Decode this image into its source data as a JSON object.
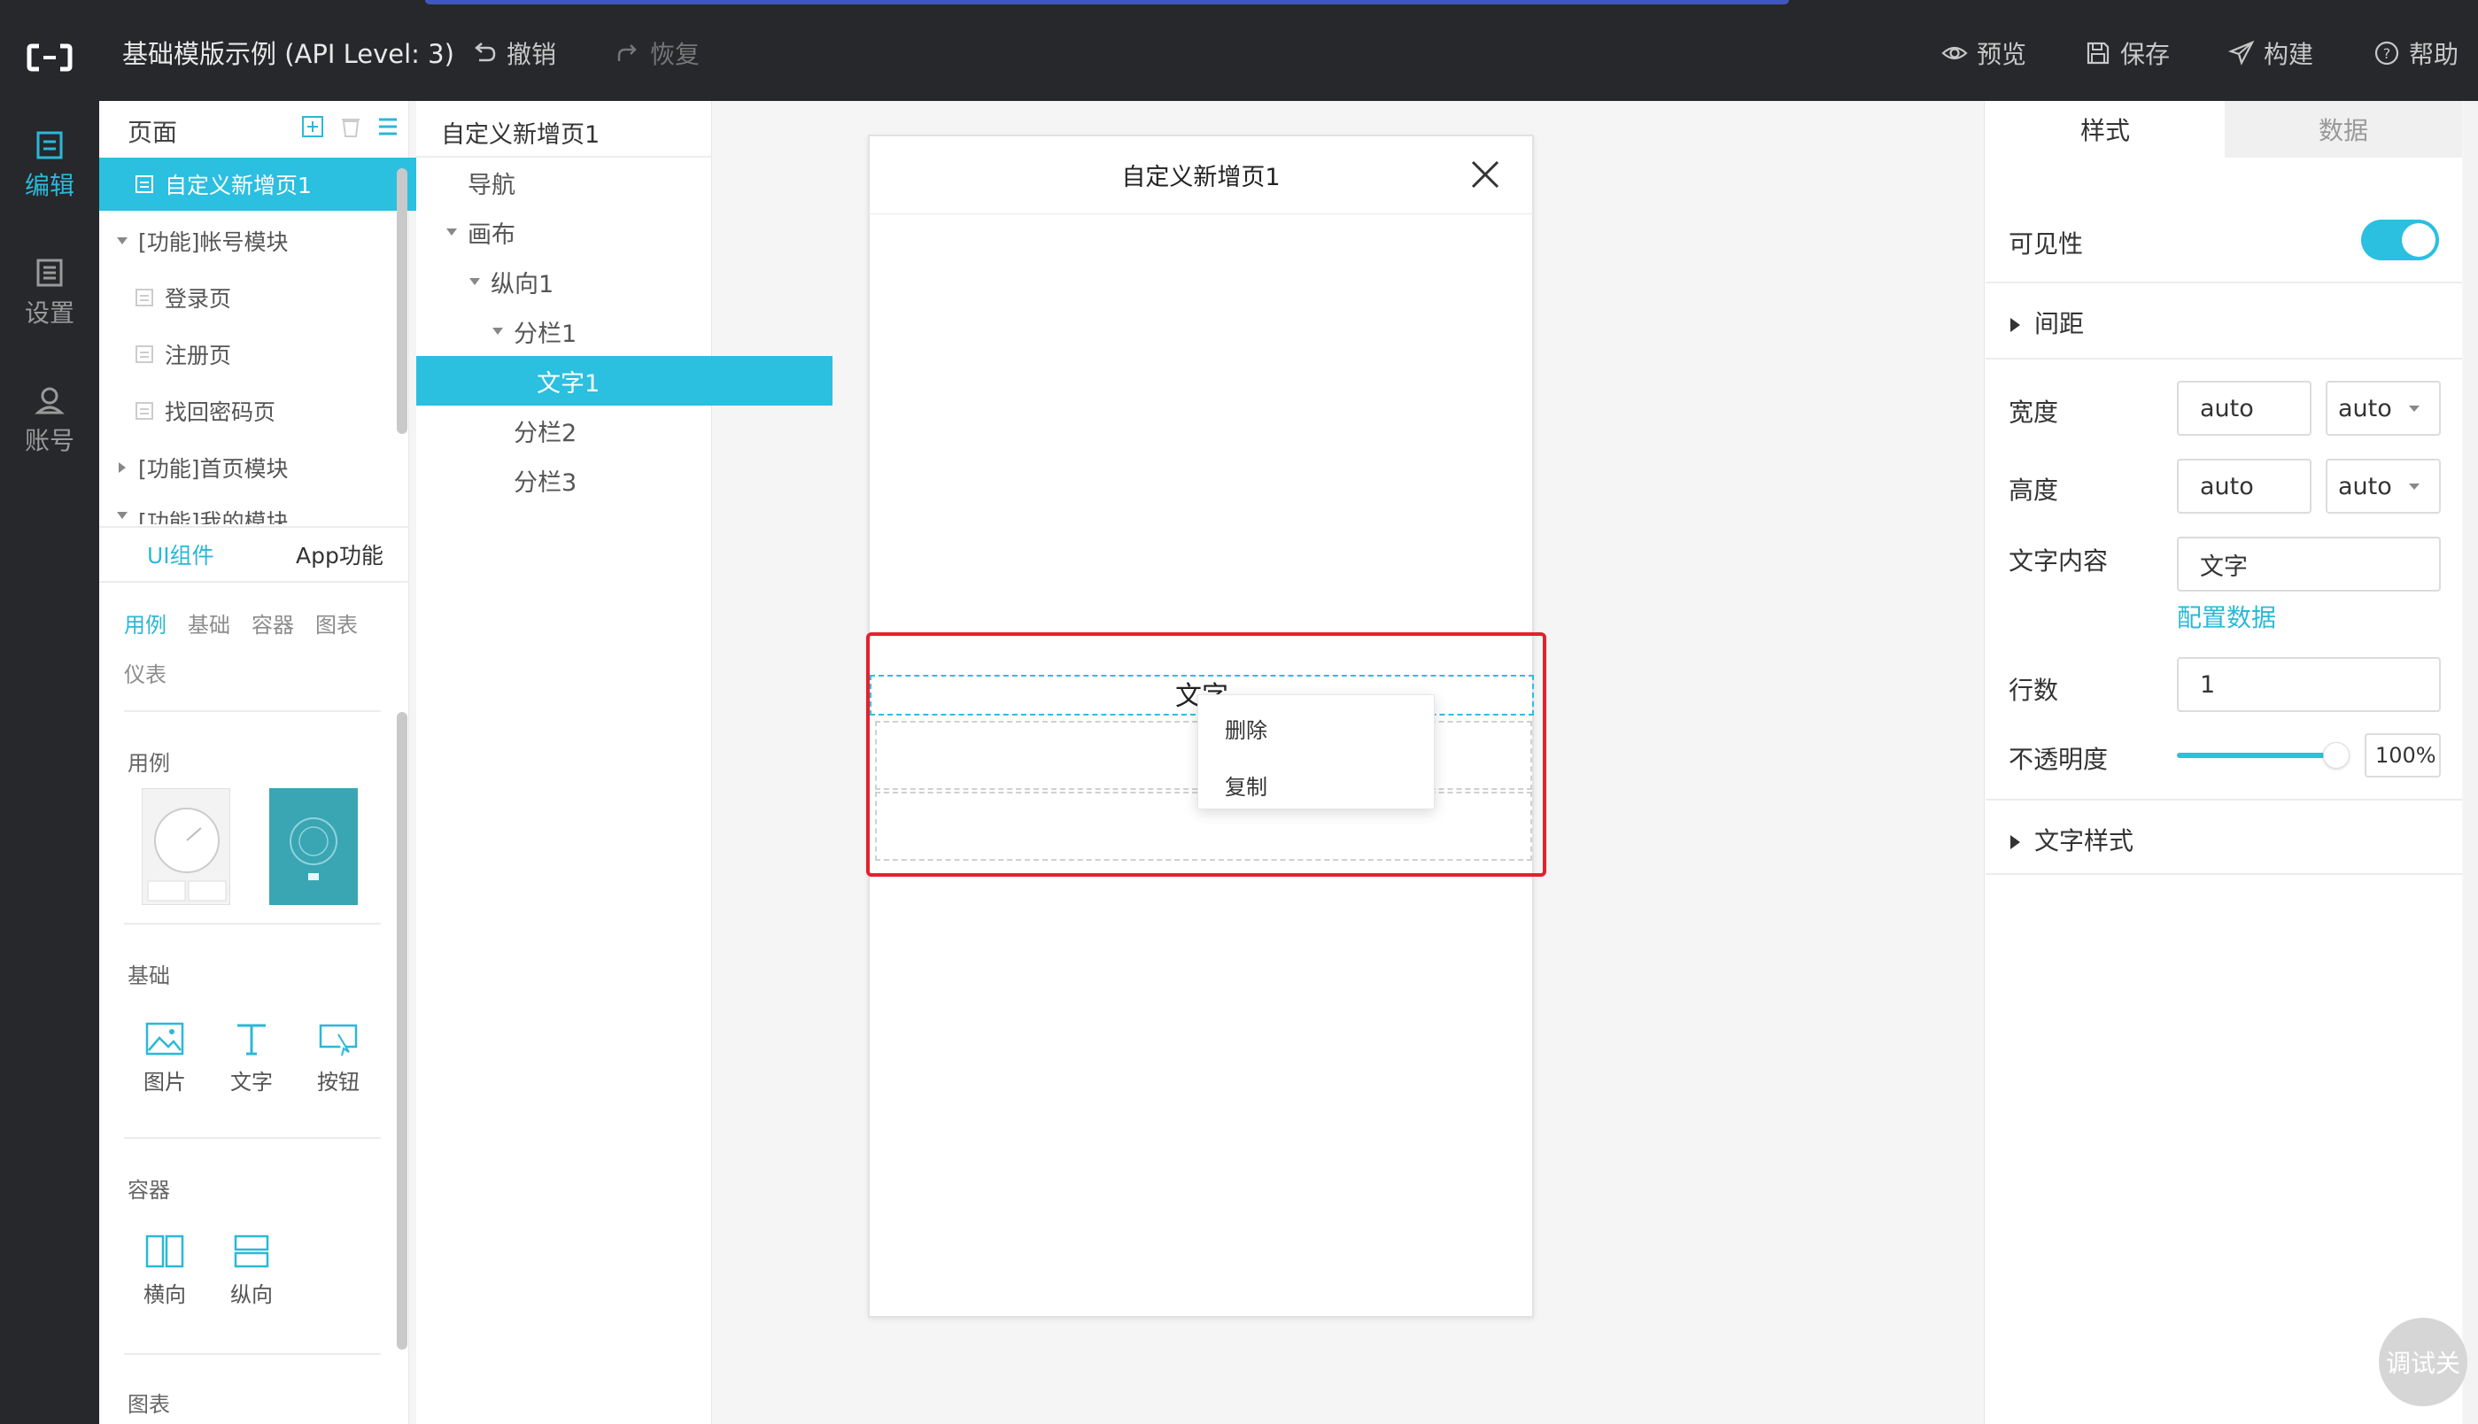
{
  "topbar": {
    "title": "基础模版示例 (API Level: 3)",
    "undo": "撤销",
    "redo": "恢复",
    "preview": "预览",
    "save": "保存",
    "build": "构建",
    "help": "帮助"
  },
  "leftnav": {
    "items": [
      {
        "label": "编辑",
        "icon": "edit-icon",
        "active": true
      },
      {
        "label": "设置",
        "icon": "settings-icon"
      },
      {
        "label": "账号",
        "icon": "user-icon"
      }
    ]
  },
  "pages": {
    "title": "页面",
    "items": [
      {
        "label": "自定义新增页1",
        "active": true
      },
      {
        "label": "[功能]帐号模块",
        "type": "group",
        "open": true
      },
      {
        "label": "登录页"
      },
      {
        "label": "注册页"
      },
      {
        "label": "找回密码页"
      },
      {
        "label": "[功能]首页模块",
        "type": "group"
      },
      {
        "label": "[功能]我的模块",
        "type": "group"
      }
    ]
  },
  "components": {
    "tabs": [
      "UI组件",
      "App功能"
    ],
    "categories": [
      "用例",
      "基础",
      "容器",
      "图表",
      "仪表"
    ],
    "sections": {
      "examples": "用例",
      "basic": "基础",
      "container": "容器",
      "chart": "图表"
    },
    "basic_items": [
      "图片",
      "文字",
      "按钮"
    ],
    "container_items": [
      "横向",
      "纵向"
    ]
  },
  "layers": {
    "title": "自定义新增页1",
    "items": [
      "导航",
      "画布",
      "纵向1",
      "分栏1",
      "文字1",
      "分栏2",
      "分栏3"
    ]
  },
  "canvas": {
    "page_title": "自定义新增页1",
    "text_widget": "文字",
    "context_menu": [
      "删除",
      "复制"
    ]
  },
  "props": {
    "tabs": [
      "样式",
      "数据"
    ],
    "visibility_label": "可见性",
    "visibility": true,
    "spacing_label": "间距",
    "width_label": "宽度",
    "width_value": "auto",
    "width_unit": "auto",
    "height_label": "高度",
    "height_value": "auto",
    "height_unit": "auto",
    "text_label": "文字内容",
    "text_value": "文字",
    "config_link": "配置数据",
    "lines_label": "行数",
    "lines_value": "1",
    "opacity_label": "不透明度",
    "opacity_value": "100%",
    "opacity_level": 1.0,
    "text_style_label": "文字样式"
  },
  "debug_button": "调试关",
  "colors": {
    "accent": "#2bbfe0",
    "highlight": "#e5202e",
    "topbar": "#27282c"
  }
}
